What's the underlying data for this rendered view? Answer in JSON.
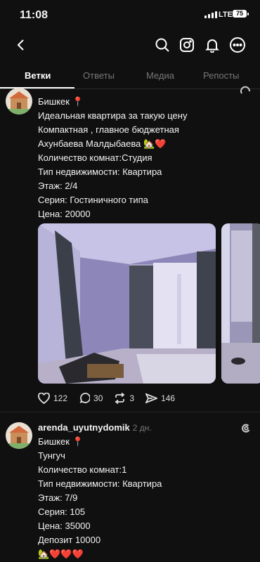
{
  "status": {
    "time": "11:08",
    "network": "LTE",
    "battery": "75"
  },
  "tabs": [
    "Ветки",
    "Ответы",
    "Медиа",
    "Репосты"
  ],
  "posts": [
    {
      "lines": [
        "Бишкек 📍",
        "Идеальная квартира за такую цену",
        "Компактная , главное бюджетная",
        "Ахунбаева Малдыбаева 🏡❤️",
        "Количество комнат:Студия",
        "Тип недвижимости: Квартира",
        "Этаж: 2/4",
        "Серия: Гостиничного типа",
        "Цена: 20000"
      ],
      "likes": "122",
      "comments": "30",
      "reposts": "3",
      "shares": "146"
    },
    {
      "username": "arenda_uyutnydomik",
      "posted": "2 дн.",
      "lines": [
        "Бишкек 📍",
        "Тунгуч",
        "Количество комнат:1",
        "Тип недвижимости: Квартира",
        "Этаж: 7/9",
        "Серия: 105",
        "Цена: 35000",
        "Депозит 10000",
        "🏡❤️❤️❤️"
      ]
    }
  ]
}
